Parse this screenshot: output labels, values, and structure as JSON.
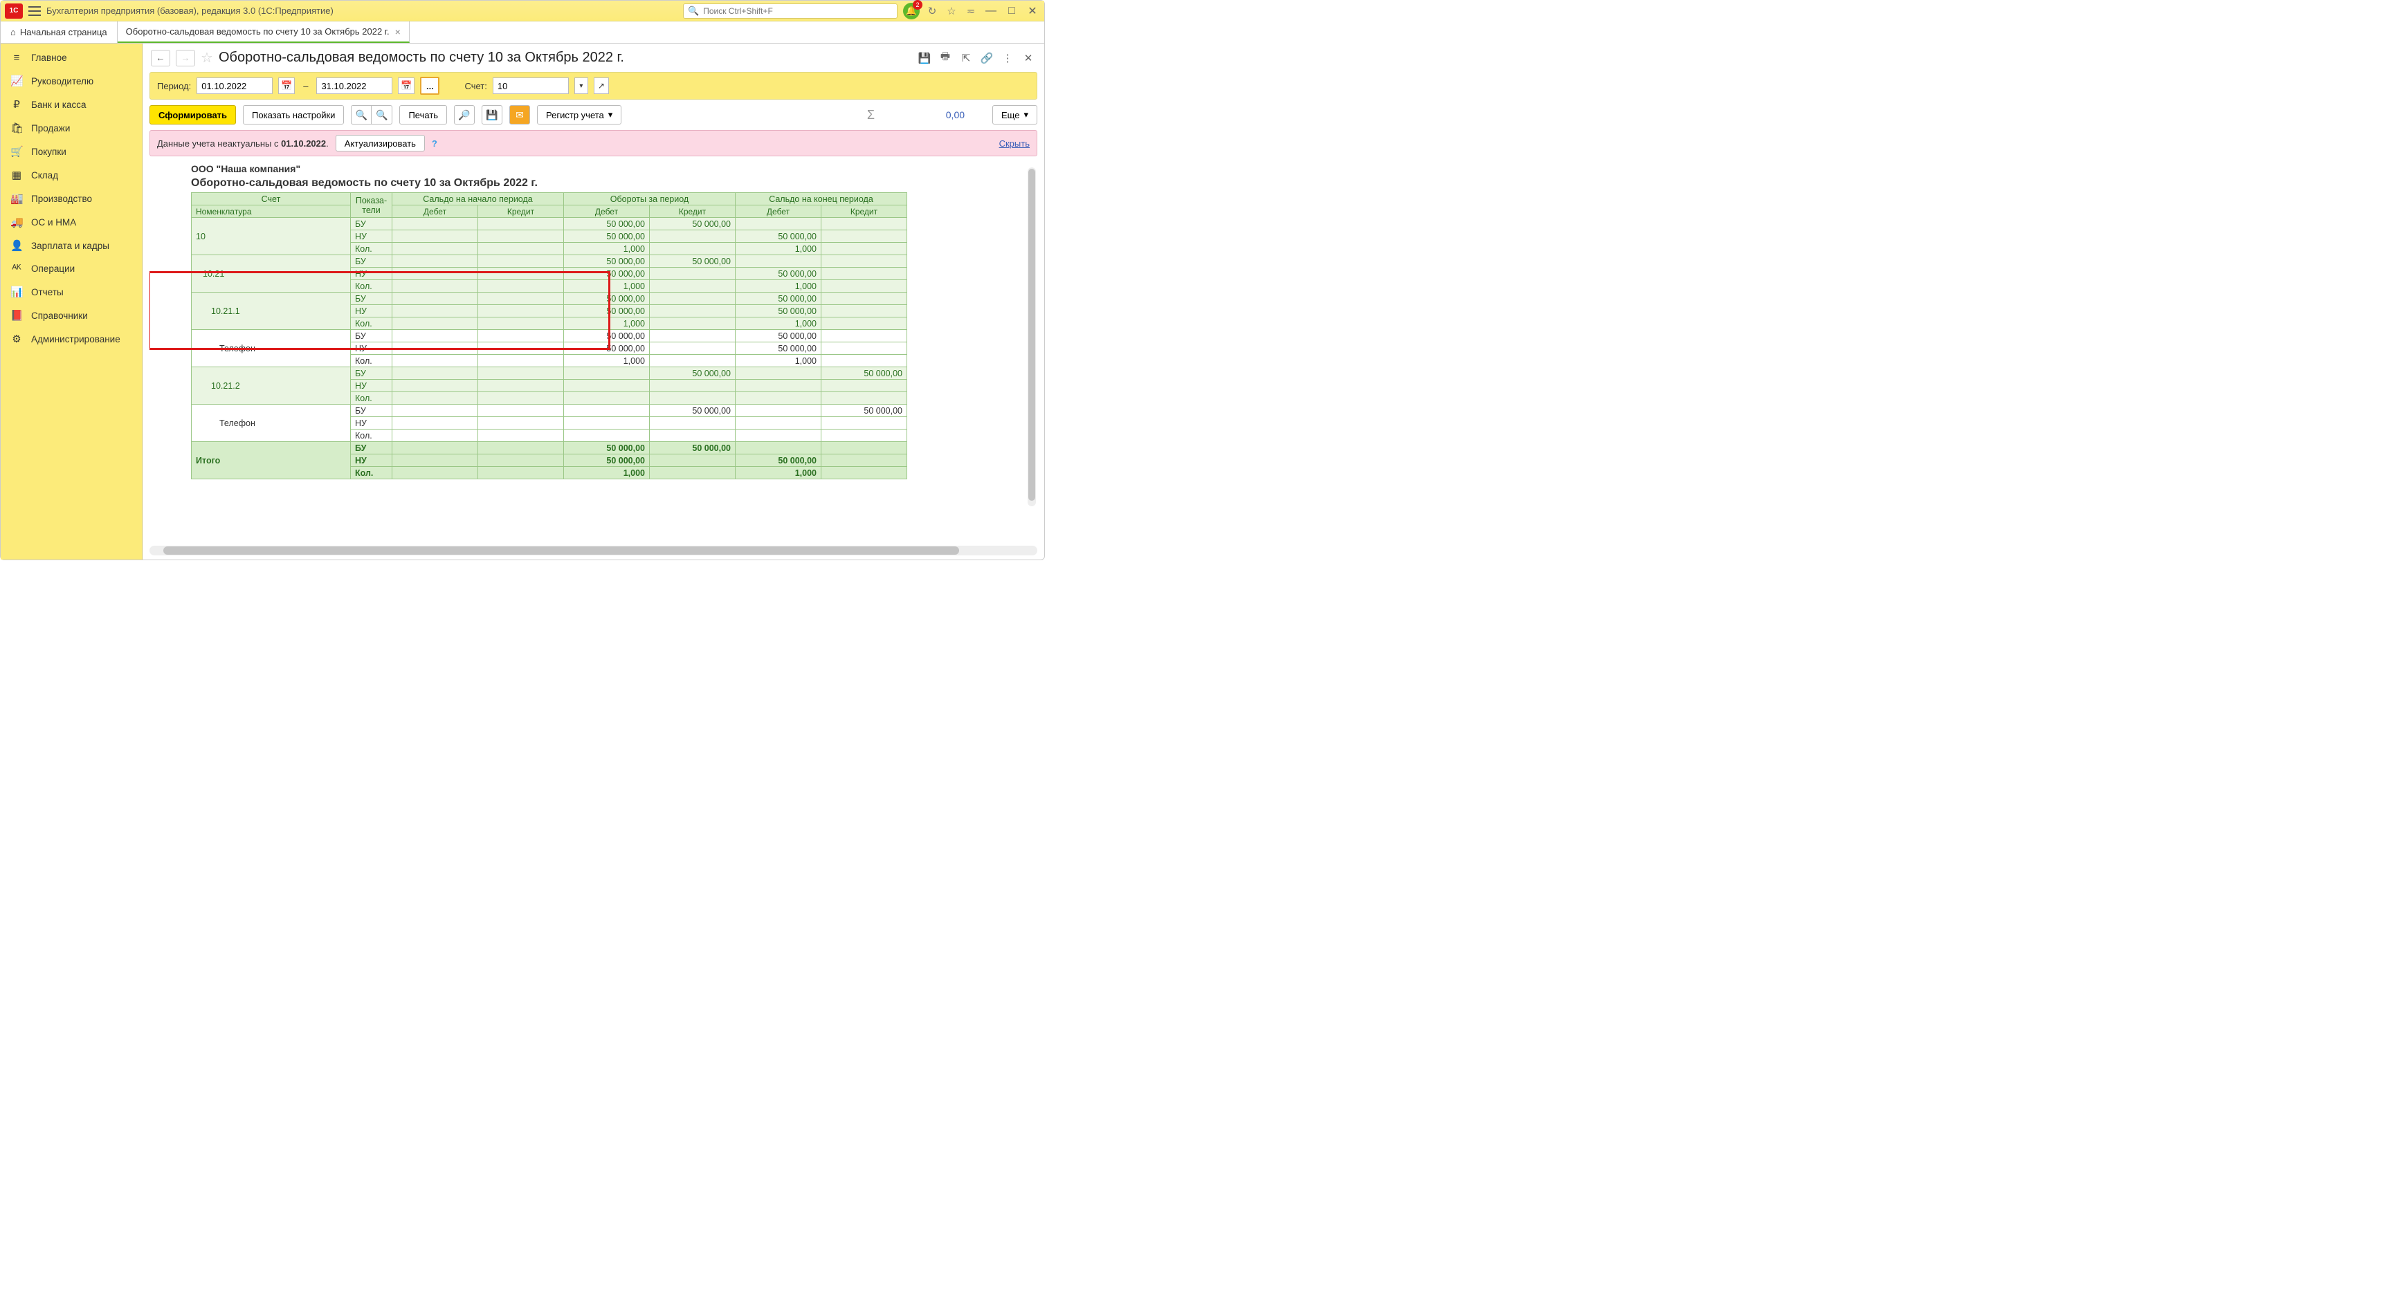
{
  "titlebar": {
    "app_title": "Бухгалтерия предприятия (базовая), редакция 3.0  (1С:Предприятие)",
    "search_placeholder": "Поиск Ctrl+Shift+F",
    "notif_count": "2"
  },
  "tabs": {
    "home": "Начальная страница",
    "doc": "Оборотно-сальдовая ведомость по счету 10 за Октябрь 2022 г."
  },
  "sidebar": [
    {
      "icon": "≡",
      "label": "Главное"
    },
    {
      "icon": "📈",
      "label": "Руководителю"
    },
    {
      "icon": "₽",
      "label": "Банк и касса"
    },
    {
      "icon": "🛍",
      "label": "Продажи"
    },
    {
      "icon": "🛒",
      "label": "Покупки"
    },
    {
      "icon": "▦",
      "label": "Склад"
    },
    {
      "icon": "🏭",
      "label": "Производство"
    },
    {
      "icon": "🚚",
      "label": "ОС и НМА"
    },
    {
      "icon": "👤",
      "label": "Зарплата и кадры"
    },
    {
      "icon": "ᴬᴷ",
      "label": "Операции"
    },
    {
      "icon": "📊",
      "label": "Отчеты"
    },
    {
      "icon": "📕",
      "label": "Справочники"
    },
    {
      "icon": "⚙",
      "label": "Администрирование"
    }
  ],
  "page": {
    "title": "Оборотно-сальдовая ведомость по счету 10 за Октябрь 2022 г."
  },
  "filter": {
    "period_label": "Период:",
    "date_from": "01.10.2022",
    "date_to": "31.10.2022",
    "account_label": "Счет:",
    "account": "10"
  },
  "toolbar": {
    "generate": "Сформировать",
    "settings": "Показать настройки",
    "print": "Печать",
    "register": "Регистр учета",
    "more": "Еще",
    "sum": "0,00"
  },
  "warning": {
    "text_a": "Данные учета неактуальны с ",
    "text_b": "01.10.2022",
    "text_c": ".",
    "update": "Актуализировать",
    "hide": "Скрыть"
  },
  "report": {
    "company": "ООО \"Наша компания\"",
    "title": "Оборотно-сальдовая ведомость по счету 10 за Октябрь 2022 г.",
    "headers": {
      "account": "Счет",
      "nomenclature": "Номенклатура",
      "indicators": "Показа-\nтели",
      "opening": "Сальдо на начало периода",
      "turnover": "Обороты за период",
      "closing": "Сальдо на конец периода",
      "debit": "Дебет",
      "credit": "Кредит"
    },
    "ind": {
      "bu": "БУ",
      "nu": "НУ",
      "kol": "Кол."
    },
    "rows": [
      {
        "level": 0,
        "acct": "10",
        "bu": {
          "od": "50 000,00",
          "oc": "50 000,00"
        },
        "nu": {
          "od": "50 000,00",
          "cd": "50 000,00"
        },
        "kol": {
          "od": "1,000",
          "cd": "1,000"
        }
      },
      {
        "level": 1,
        "acct": "10.21",
        "bu": {
          "od": "50 000,00",
          "oc": "50 000,00"
        },
        "nu": {
          "od": "50 000,00",
          "cd": "50 000,00"
        },
        "kol": {
          "od": "1,000",
          "cd": "1,000"
        }
      },
      {
        "level": 2,
        "acct": "10.21.1",
        "bu": {
          "od": "50 000,00",
          "cd": "50 000,00"
        },
        "nu": {
          "od": "50 000,00",
          "cd": "50 000,00"
        },
        "kol": {
          "od": "1,000",
          "cd": "1,000"
        }
      },
      {
        "level": 3,
        "acct": "Телефон",
        "white": true,
        "bu": {
          "od": "50 000,00",
          "cd": "50 000,00"
        },
        "nu": {
          "od": "50 000,00",
          "cd": "50 000,00"
        },
        "kol": {
          "od": "1,000",
          "cd": "1,000"
        }
      },
      {
        "level": 2,
        "acct": "10.21.2",
        "bu": {
          "oc": "50 000,00",
          "cc": "50 000,00"
        },
        "nu": {},
        "kol": {}
      },
      {
        "level": 3,
        "acct": "Телефон",
        "white": true,
        "bu": {
          "oc": "50 000,00",
          "cc": "50 000,00"
        },
        "nu": {},
        "kol": {}
      }
    ],
    "total_label": "Итого",
    "total": {
      "bu": {
        "od": "50 000,00",
        "oc": "50 000,00"
      },
      "nu": {
        "od": "50 000,00",
        "cd": "50 000,00"
      },
      "kol": {
        "od": "1,000",
        "cd": "1,000"
      }
    }
  }
}
